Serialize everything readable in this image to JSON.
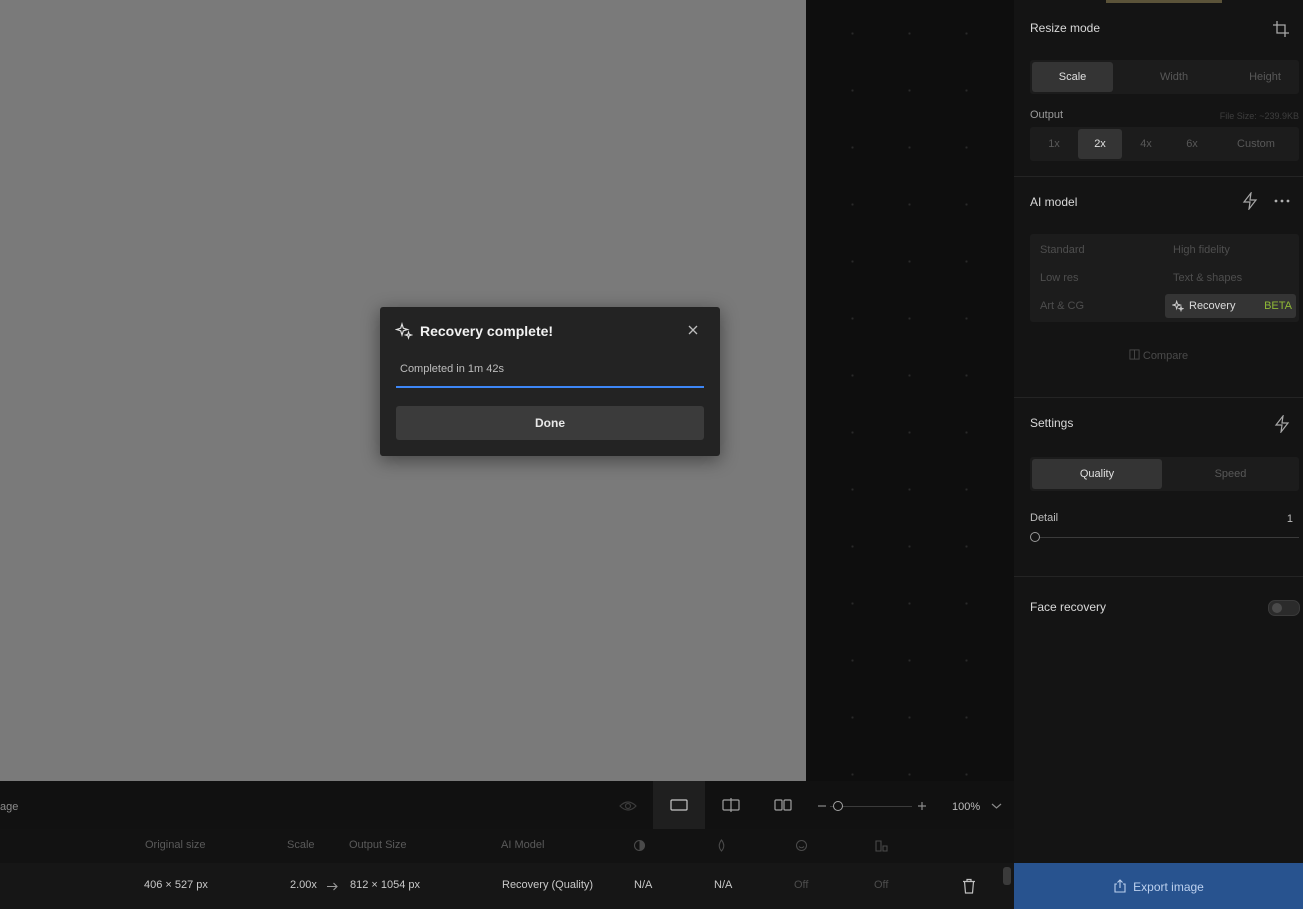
{
  "dialog": {
    "title": "Recovery complete!",
    "status": "Completed in 1m 42s",
    "done_label": "Done"
  },
  "resize": {
    "title": "Resize mode",
    "modes": [
      "Scale",
      "Width",
      "Height"
    ],
    "active_mode": "Scale",
    "output_label": "Output",
    "file_size": "File Size: ~239.9KB",
    "scales": [
      "1x",
      "2x",
      "4x",
      "6x",
      "Custom"
    ],
    "active_scale": "2x"
  },
  "ai_model": {
    "title": "AI model",
    "models": [
      "Standard",
      "High fidelity",
      "Low res",
      "Text & shapes",
      "Art & CG",
      "Recovery"
    ],
    "active_model": "Recovery",
    "beta_badge": "BETA",
    "compare_label": "Compare"
  },
  "settings": {
    "title": "Settings",
    "modes": [
      "Quality",
      "Speed"
    ],
    "active_mode": "Quality",
    "detail_label": "Detail",
    "detail_value": "1"
  },
  "face_recovery": {
    "label": "Face recovery",
    "enabled": false
  },
  "export_label": "Export image",
  "toolbar": {
    "left_label": "age",
    "zoom": "100%"
  },
  "table": {
    "headers": {
      "original_size": "Original size",
      "scale": "Scale",
      "output_size": "Output Size",
      "ai_model": "AI Model"
    },
    "row": {
      "original_size": "406 × 527 px",
      "scale": "2.00x",
      "output_size": "812 × 1054 px",
      "ai_model": "Recovery (Quality)",
      "col1": "N/A",
      "col2": "N/A",
      "col3": "Off",
      "col4": "Off"
    }
  },
  "colors": {
    "accent_blue": "#3d86f6",
    "export_bg": "#28538f",
    "beta_green": "#8fb936"
  },
  "icons": [
    "sparkle-icon",
    "close-icon",
    "crop-icon",
    "lightning-icon",
    "more-icon",
    "compare-icon",
    "export-icon",
    "eye-icon",
    "trash-icon"
  ]
}
